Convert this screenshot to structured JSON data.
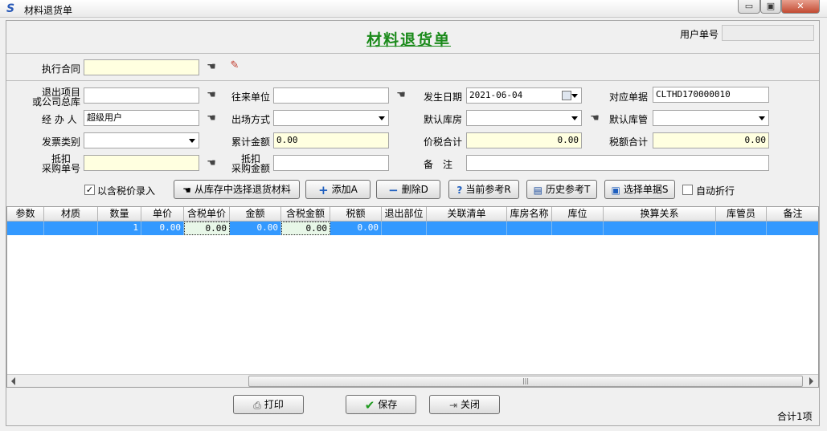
{
  "window": {
    "title": "材料退货单"
  },
  "doc_title": "材料退货单",
  "header": {
    "user_no_label": "用户单号",
    "user_no_value": ""
  },
  "contract": {
    "label": "执行合同",
    "value": ""
  },
  "form": {
    "exit_project_label_1": "退出项目",
    "exit_project_label_2": "或公司总库",
    "exit_project_value": "",
    "partner_label": "往来单位",
    "partner_value": "",
    "date_label": "发生日期",
    "date_value": "2021-06-04",
    "ref_doc_label": "对应单据",
    "ref_doc_value": "CLTHD170000010",
    "handler_label": "经 办 人",
    "handler_value": "超级用户",
    "exit_mode_label": "出场方式",
    "exit_mode_value": "",
    "default_store_label": "默认库房",
    "default_store_value": "",
    "default_keeper_label": "默认库管",
    "default_keeper_value": "",
    "invoice_type_label": "发票类别",
    "invoice_type_value": "",
    "total_amount_label": "累计金额",
    "total_amount_value": "0.00",
    "tax_total_price_label": "价税合计",
    "tax_total_price_value": "0.00",
    "tax_sum_label": "税额合计",
    "tax_sum_value": "0.00",
    "deduct_no_label_1": "抵扣",
    "deduct_no_label_2": "采购单号",
    "deduct_no_value": "",
    "deduct_amt_label_1": "抵扣",
    "deduct_amt_label_2": "采购金额",
    "deduct_amt_value": "",
    "remark_label": "备　注",
    "remark_value": ""
  },
  "toolbar": {
    "tax_price_entry_label": "以含税价录入",
    "tax_price_entry_checked": true,
    "select_from_stock_label": "从库存中选择退货材料",
    "add_label": "添加A",
    "delete_label": "删除D",
    "current_ref_label": "当前参考R",
    "history_ref_label": "历史参考T",
    "select_doc_label": "选择单据S",
    "auto_discount_label": "自动折行",
    "auto_discount_checked": false
  },
  "grid": {
    "columns": [
      "参数",
      "材质",
      "数量",
      "单价",
      "含税单价",
      "金额",
      "含税金额",
      "税额",
      "退出部位",
      "关联清单",
      "库房名称",
      "库位",
      "换算关系",
      "库管员",
      "备注"
    ],
    "rows": [
      [
        "",
        "",
        "1",
        "0.00",
        "0.00",
        "0.00",
        "0.00",
        "0.00",
        "",
        "",
        "",
        "",
        "",
        "",
        ""
      ]
    ]
  },
  "footer": {
    "print_label": "打印",
    "save_label": "保存",
    "close_label": "关闭",
    "total_count": "合计1项"
  },
  "colors": {
    "doc_title": "#1a8a1a",
    "selected_row": "#3399ff",
    "highlight_field": "#ffffe0"
  }
}
